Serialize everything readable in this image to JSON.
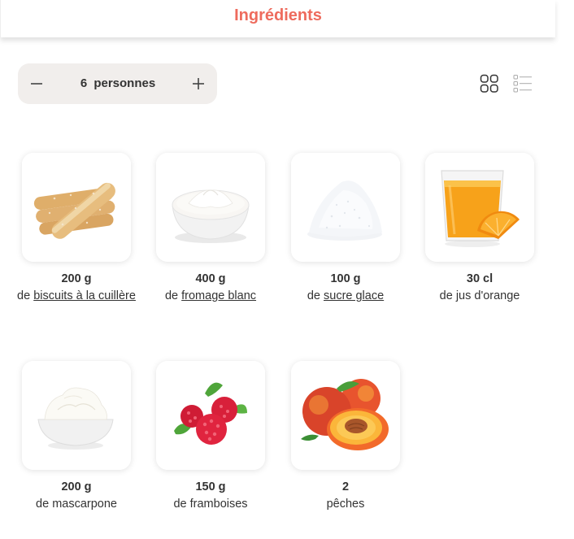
{
  "header": {
    "title": "Ingrédients"
  },
  "servings": {
    "count": "6",
    "unit": "personnes",
    "minus_label": "−",
    "plus_label": "+"
  },
  "view": {
    "grid_icon": "grid-view-icon",
    "list_icon": "list-view-icon",
    "active": "grid"
  },
  "ingredients": [
    {
      "qty": "200 g",
      "prefix": "de ",
      "name": "biscuits à la cuillère",
      "linked": true,
      "image": "ladyfingers"
    },
    {
      "qty": "400 g",
      "prefix": "de ",
      "name": "fromage blanc",
      "linked": true,
      "image": "fromage-blanc"
    },
    {
      "qty": "100 g",
      "prefix": "de ",
      "name": "sucre glace",
      "linked": true,
      "image": "powdered-sugar"
    },
    {
      "qty": "30 cl",
      "prefix": "de ",
      "name": "jus d'orange",
      "linked": false,
      "image": "orange-juice"
    },
    {
      "qty": "200 g",
      "prefix": "de ",
      "name": "mascarpone",
      "linked": false,
      "image": "mascarpone"
    },
    {
      "qty": "150 g",
      "prefix": "de ",
      "name": "framboises",
      "linked": false,
      "image": "raspberries"
    },
    {
      "qty": "2",
      "prefix": "",
      "name": "pêches",
      "linked": false,
      "image": "peaches"
    }
  ],
  "colors": {
    "accent": "#ee6b5d",
    "pill_bg": "#f1eeec",
    "text": "#333333"
  }
}
